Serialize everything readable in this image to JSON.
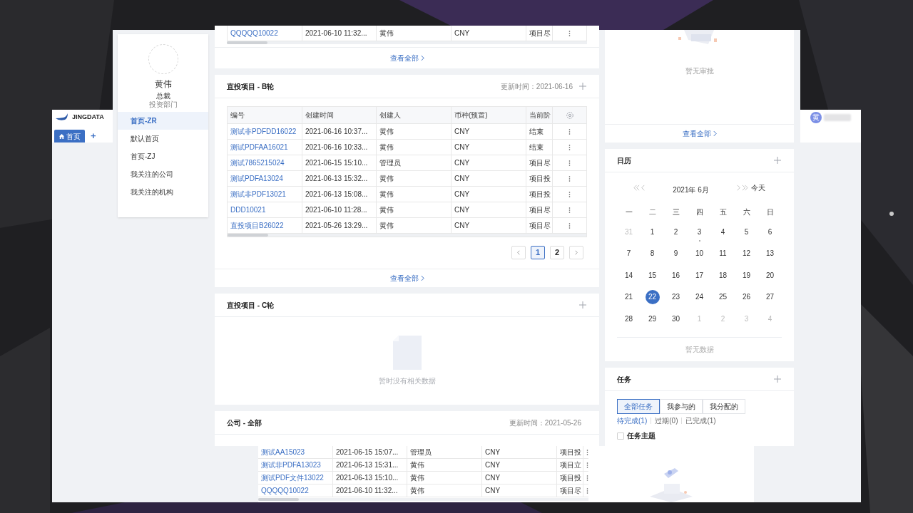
{
  "logo": {
    "text": "JINGDATA"
  },
  "page_tabs": [
    {
      "label": "首页",
      "selected": true
    }
  ],
  "add_tab": "+",
  "user_chip": {
    "avatar": "黄"
  },
  "profile": {
    "name": "黄伟",
    "title": "总裁",
    "department": "投资部门"
  },
  "sidebar": {
    "items": [
      {
        "label": "首页-ZR",
        "selected": true
      },
      {
        "label": "默认首页",
        "selected": false
      },
      {
        "label": "首页-ZJ",
        "selected": false
      },
      {
        "label": "我关注的公司",
        "selected": false
      },
      {
        "label": "我关注的机构",
        "selected": false
      }
    ]
  },
  "top_card": {
    "rows": [
      [
        "QQQQQ10022",
        "2021-06-10 11:32...",
        "黄伟",
        "CNY",
        "项目尽"
      ]
    ],
    "view_all": "查看全部"
  },
  "b_round": {
    "title": "直投项目 - B轮",
    "updated": "更新时间：2021-06-16",
    "columns": [
      "编号",
      "创建时间",
      "创建人",
      "币种(预置)",
      "当前阶"
    ],
    "rows": [
      [
        "测试非PDFDD16022",
        "2021-06-16 10:37...",
        "黄伟",
        "CNY",
        "结束"
      ],
      [
        "测试PDFAA16021",
        "2021-06-16 10:33...",
        "黄伟",
        "CNY",
        "结束"
      ],
      [
        "测试7865215024",
        "2021-06-15 15:10...",
        "管理员",
        "CNY",
        "项目尽"
      ],
      [
        "测试PDFA13024",
        "2021-06-13 15:32...",
        "黄伟",
        "CNY",
        "项目投"
      ],
      [
        "测试非PDF13021",
        "2021-06-13 15:08...",
        "黄伟",
        "CNY",
        "项目投"
      ],
      [
        "DDD10021",
        "2021-06-10 11:28...",
        "黄伟",
        "CNY",
        "项目尽"
      ],
      [
        "直投项目B26022",
        "2021-05-26 13:29...",
        "黄伟",
        "CNY",
        "项目尽"
      ]
    ],
    "pages": [
      {
        "label": "1",
        "selected": true
      },
      {
        "label": "2",
        "selected": false
      }
    ],
    "view_all": "查看全部"
  },
  "c_round": {
    "title": "直投项目 - C轮",
    "empty_text": "暂时没有相关数据"
  },
  "companies": {
    "title": "公司 - 全部",
    "updated": "更新时间：2021-05-26"
  },
  "overlay_table": {
    "rows": [
      [
        "测试AA15023",
        "2021-06-15 15:07...",
        "管理员",
        "CNY",
        "项目投"
      ],
      [
        "测试非PDFA13023",
        "2021-06-13 15:31...",
        "黄伟",
        "CNY",
        "项目立"
      ],
      [
        "测试PDF文件13022",
        "2021-06-13 15:10...",
        "黄伟",
        "CNY",
        "项目投"
      ],
      [
        "QQQQQ10022",
        "2021-06-10 11:32...",
        "黄伟",
        "CNY",
        "项目尽"
      ]
    ]
  },
  "approvals": {
    "empty_text": "暂无审批",
    "view_all": "查看全部"
  },
  "calendar": {
    "title": "日历",
    "month": "2021年 6月",
    "today": "今天",
    "weekdays": [
      "一",
      "二",
      "三",
      "四",
      "五",
      "六",
      "日"
    ],
    "days": [
      {
        "label": "31",
        "outside": true,
        "selected": false,
        "event": false
      },
      {
        "label": "1",
        "outside": false,
        "selected": false,
        "event": false
      },
      {
        "label": "2",
        "outside": false,
        "selected": false,
        "event": false
      },
      {
        "label": "3",
        "outside": false,
        "selected": false,
        "event": true
      },
      {
        "label": "4",
        "outside": false,
        "selected": false,
        "event": false
      },
      {
        "label": "5",
        "outside": false,
        "selected": false,
        "event": false
      },
      {
        "label": "6",
        "outside": false,
        "selected": false,
        "event": false
      },
      {
        "label": "7",
        "outside": false,
        "selected": false,
        "event": false
      },
      {
        "label": "8",
        "outside": false,
        "selected": false,
        "event": false
      },
      {
        "label": "9",
        "outside": false,
        "selected": false,
        "event": false
      },
      {
        "label": "10",
        "outside": false,
        "selected": false,
        "event": false
      },
      {
        "label": "11",
        "outside": false,
        "selected": false,
        "event": false
      },
      {
        "label": "12",
        "outside": false,
        "selected": false,
        "event": false
      },
      {
        "label": "13",
        "outside": false,
        "selected": false,
        "event": false
      },
      {
        "label": "14",
        "outside": false,
        "selected": false,
        "event": false
      },
      {
        "label": "15",
        "outside": false,
        "selected": false,
        "event": false
      },
      {
        "label": "16",
        "outside": false,
        "selected": false,
        "event": false
      },
      {
        "label": "17",
        "outside": false,
        "selected": false,
        "event": false
      },
      {
        "label": "18",
        "outside": false,
        "selected": false,
        "event": false
      },
      {
        "label": "19",
        "outside": false,
        "selected": false,
        "event": false
      },
      {
        "label": "20",
        "outside": false,
        "selected": false,
        "event": false
      },
      {
        "label": "21",
        "outside": false,
        "selected": false,
        "event": false
      },
      {
        "label": "22",
        "outside": false,
        "selected": true,
        "event": false
      },
      {
        "label": "23",
        "outside": false,
        "selected": false,
        "event": false
      },
      {
        "label": "24",
        "outside": false,
        "selected": false,
        "event": false
      },
      {
        "label": "25",
        "outside": false,
        "selected": false,
        "event": false
      },
      {
        "label": "26",
        "outside": false,
        "selected": false,
        "event": false
      },
      {
        "label": "27",
        "outside": false,
        "selected": false,
        "event": false
      },
      {
        "label": "28",
        "outside": false,
        "selected": false,
        "event": false
      },
      {
        "label": "29",
        "outside": false,
        "selected": false,
        "event": false
      },
      {
        "label": "30",
        "outside": false,
        "selected": false,
        "event": false
      },
      {
        "label": "1",
        "outside": true,
        "selected": false,
        "event": false
      },
      {
        "label": "2",
        "outside": true,
        "selected": false,
        "event": false
      },
      {
        "label": "3",
        "outside": true,
        "selected": false,
        "event": false
      },
      {
        "label": "4",
        "outside": true,
        "selected": false,
        "event": false
      }
    ],
    "empty_text": "暂无数据"
  },
  "tasks": {
    "title": "任务",
    "tabs": [
      {
        "label": "全部任务",
        "selected": true
      },
      {
        "label": "我参与的",
        "selected": false
      },
      {
        "label": "我分配的",
        "selected": false
      }
    ],
    "filters": [
      {
        "label": "待完成(1)",
        "selected": true
      },
      {
        "label": "过期(0)",
        "selected": false
      },
      {
        "label": "已完成(1)",
        "selected": false
      }
    ],
    "column": {
      "label": "任务主题",
      "checked": false
    }
  }
}
